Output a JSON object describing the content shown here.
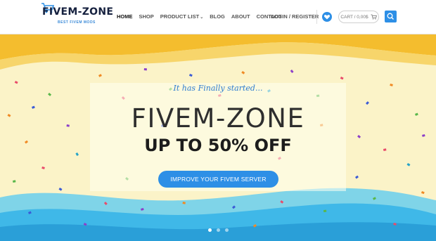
{
  "logo": {
    "title": "FIVEM-ZONE",
    "subtitle": "BEST FIVEM MODS"
  },
  "nav": {
    "items": [
      {
        "label": "HOME",
        "active": true
      },
      {
        "label": "SHOP"
      },
      {
        "label": "PRODUCT LIST",
        "dropdown": true
      },
      {
        "label": "BLOG"
      },
      {
        "label": "ABOUT"
      },
      {
        "label": "CONTACT"
      }
    ],
    "dropdown_glyph": "⌄"
  },
  "account": {
    "login_label": "LOGIN / REGISTER"
  },
  "cart": {
    "label": "CART / 0,00$"
  },
  "hero": {
    "tagline": "It has Finally started...",
    "title": "FIVEM-ZONE",
    "subtitle": "UP TO 50% OFF",
    "cta": "IMPROVE YOUR FIVEM SERVER"
  },
  "colors": {
    "accent": "#2d8fe6",
    "wave_blue": "#3fb8e8",
    "wave_yellow": "#f4bd2e",
    "sky": "#fbf3c8"
  },
  "icons": [
    "cart-icon",
    "chevron-down-icon",
    "heart-icon",
    "basket-icon",
    "search-icon"
  ]
}
